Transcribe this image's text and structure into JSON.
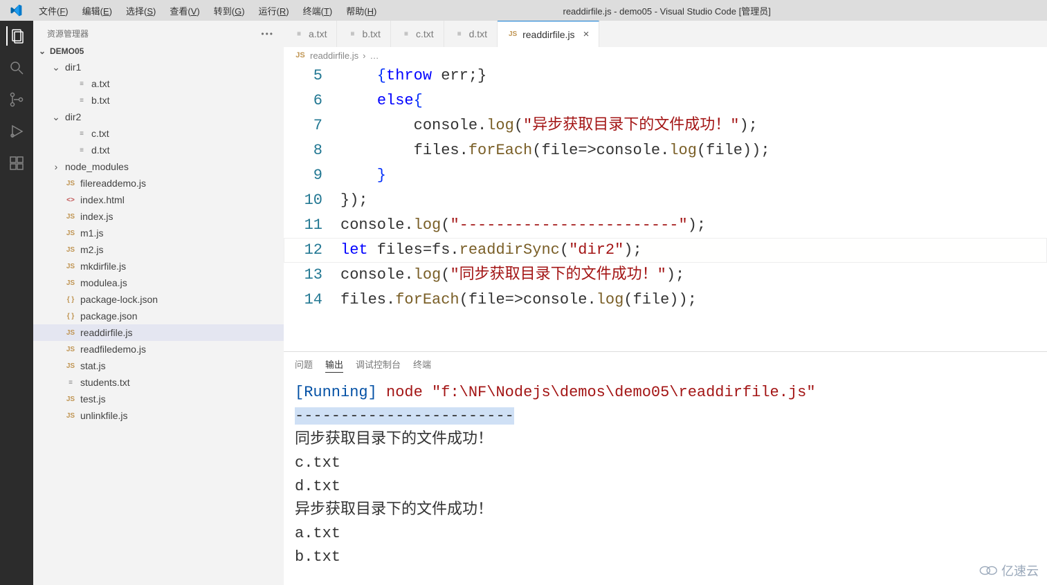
{
  "window_title": "readdirfile.js - demo05 - Visual Studio Code [管理员]",
  "menu": [
    {
      "label": "文件",
      "accel": "F"
    },
    {
      "label": "编辑",
      "accel": "E"
    },
    {
      "label": "选择",
      "accel": "S"
    },
    {
      "label": "查看",
      "accel": "V"
    },
    {
      "label": "转到",
      "accel": "G"
    },
    {
      "label": "运行",
      "accel": "R"
    },
    {
      "label": "终端",
      "accel": "T"
    },
    {
      "label": "帮助",
      "accel": "H"
    }
  ],
  "sidebar": {
    "title": "资源管理器",
    "project": "DEMO05",
    "tree": [
      {
        "type": "folder",
        "name": "dir1",
        "depth": 1,
        "open": true
      },
      {
        "type": "file",
        "name": "a.txt",
        "depth": 2,
        "icon": "txt"
      },
      {
        "type": "file",
        "name": "b.txt",
        "depth": 2,
        "icon": "txt"
      },
      {
        "type": "folder",
        "name": "dir2",
        "depth": 1,
        "open": true
      },
      {
        "type": "file",
        "name": "c.txt",
        "depth": 2,
        "icon": "txt"
      },
      {
        "type": "file",
        "name": "d.txt",
        "depth": 2,
        "icon": "txt"
      },
      {
        "type": "folder",
        "name": "node_modules",
        "depth": 1,
        "open": false
      },
      {
        "type": "file",
        "name": "filereaddemo.js",
        "depth": 1,
        "icon": "js"
      },
      {
        "type": "file",
        "name": "index.html",
        "depth": 1,
        "icon": "html"
      },
      {
        "type": "file",
        "name": "index.js",
        "depth": 1,
        "icon": "js"
      },
      {
        "type": "file",
        "name": "m1.js",
        "depth": 1,
        "icon": "js"
      },
      {
        "type": "file",
        "name": "m2.js",
        "depth": 1,
        "icon": "js"
      },
      {
        "type": "file",
        "name": "mkdirfile.js",
        "depth": 1,
        "icon": "js"
      },
      {
        "type": "file",
        "name": "modulea.js",
        "depth": 1,
        "icon": "js"
      },
      {
        "type": "file",
        "name": "package-lock.json",
        "depth": 1,
        "icon": "json"
      },
      {
        "type": "file",
        "name": "package.json",
        "depth": 1,
        "icon": "json"
      },
      {
        "type": "file",
        "name": "readdirfile.js",
        "depth": 1,
        "icon": "js",
        "selected": true
      },
      {
        "type": "file",
        "name": "readfiledemo.js",
        "depth": 1,
        "icon": "js"
      },
      {
        "type": "file",
        "name": "stat.js",
        "depth": 1,
        "icon": "js"
      },
      {
        "type": "file",
        "name": "students.txt",
        "depth": 1,
        "icon": "txt"
      },
      {
        "type": "file",
        "name": "test.js",
        "depth": 1,
        "icon": "js"
      },
      {
        "type": "file",
        "name": "unlinkfile.js",
        "depth": 1,
        "icon": "js"
      }
    ]
  },
  "tabs": [
    {
      "label": "a.txt",
      "icon": "txt"
    },
    {
      "label": "b.txt",
      "icon": "txt"
    },
    {
      "label": "c.txt",
      "icon": "txt"
    },
    {
      "label": "d.txt",
      "icon": "txt"
    },
    {
      "label": "readdirfile.js",
      "icon": "js",
      "active": true,
      "close": true
    }
  ],
  "breadcrumb": {
    "file": "readdirfile.js",
    "more": "…"
  },
  "code": [
    {
      "n": 5,
      "tokens": [
        [
          "    {",
          "br"
        ],
        [
          "throw",
          "kw"
        ],
        [
          " err;}",
          ""
        ]
      ]
    },
    {
      "n": 6,
      "tokens": [
        [
          "    ",
          ""
        ],
        [
          "else",
          "kw"
        ],
        [
          "{",
          "br"
        ]
      ]
    },
    {
      "n": 7,
      "tokens": [
        [
          "        console.",
          ""
        ],
        [
          "log",
          "fn"
        ],
        [
          "(",
          ""
        ],
        [
          "\"异步获取目录下的文件成功！\"",
          "str"
        ],
        [
          ");",
          ""
        ]
      ]
    },
    {
      "n": 8,
      "tokens": [
        [
          "        files.",
          ""
        ],
        [
          "forEach",
          "fn"
        ],
        [
          "(file=>console.",
          ""
        ],
        [
          "log",
          "fn"
        ],
        [
          "(file));",
          ""
        ]
      ]
    },
    {
      "n": 9,
      "tokens": [
        [
          "    }",
          "br"
        ]
      ]
    },
    {
      "n": 10,
      "tokens": [
        [
          "});",
          ""
        ]
      ]
    },
    {
      "n": 11,
      "tokens": [
        [
          "console.",
          ""
        ],
        [
          "log",
          "fn"
        ],
        [
          "(",
          ""
        ],
        [
          "\"------------------------\"",
          "str"
        ],
        [
          ");",
          ""
        ]
      ]
    },
    {
      "n": 12,
      "current": true,
      "tokens": [
        [
          "let",
          "kw"
        ],
        [
          " files=fs.",
          ""
        ],
        [
          "readdirSync",
          "fn"
        ],
        [
          "(",
          ""
        ],
        [
          "\"dir2\"",
          "str"
        ],
        [
          ");",
          ""
        ]
      ]
    },
    {
      "n": 13,
      "tokens": [
        [
          "console.",
          ""
        ],
        [
          "log",
          "fn"
        ],
        [
          "(",
          ""
        ],
        [
          "\"同步获取目录下的文件成功！\"",
          "str"
        ],
        [
          ");",
          ""
        ]
      ]
    },
    {
      "n": 14,
      "tokens": [
        [
          "files.",
          ""
        ],
        [
          "forEach",
          "fn"
        ],
        [
          "(file=>console.",
          ""
        ],
        [
          "log",
          "fn"
        ],
        [
          "(file));",
          ""
        ]
      ]
    }
  ],
  "panel": {
    "tabs": [
      "问题",
      "输出",
      "调试控制台",
      "终端"
    ],
    "active_tab": "输出",
    "lines": [
      {
        "parts": [
          {
            "t": "[Running]",
            "cls": "term-blue"
          },
          {
            "t": " ",
            "cls": ""
          },
          {
            "t": "node \"f:\\NF\\Nodejs\\demos\\demo05\\readdirfile.js\"",
            "cls": "term-red"
          }
        ]
      },
      {
        "parts": [
          {
            "t": "------------------------",
            "cls": "term-hl"
          }
        ]
      },
      {
        "parts": [
          {
            "t": "同步获取目录下的文件成功！",
            "cls": ""
          }
        ]
      },
      {
        "parts": [
          {
            "t": "c.txt",
            "cls": ""
          }
        ]
      },
      {
        "parts": [
          {
            "t": "d.txt",
            "cls": ""
          }
        ]
      },
      {
        "parts": [
          {
            "t": "异步获取目录下的文件成功！",
            "cls": ""
          }
        ]
      },
      {
        "parts": [
          {
            "t": "a.txt",
            "cls": ""
          }
        ]
      },
      {
        "parts": [
          {
            "t": "b.txt",
            "cls": ""
          }
        ]
      }
    ]
  },
  "watermark": "亿速云"
}
